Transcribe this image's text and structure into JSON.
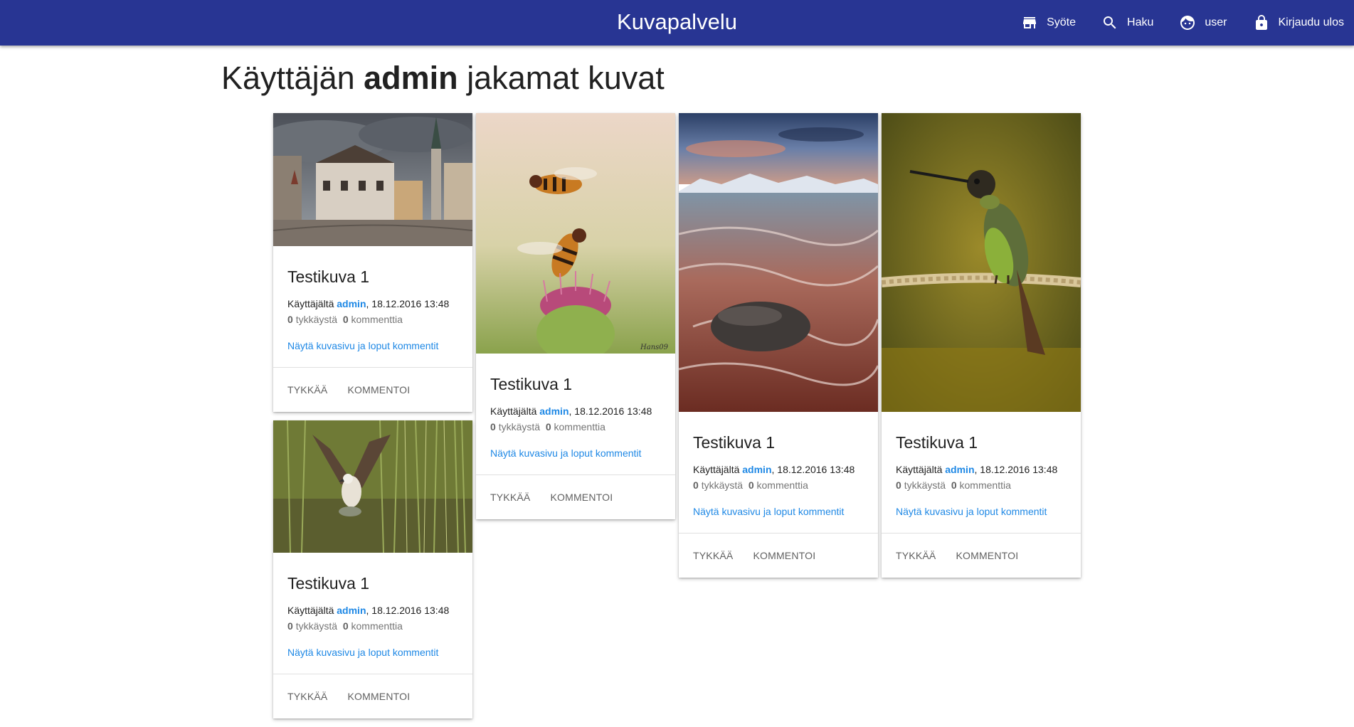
{
  "app": {
    "title": "Kuvapalvelu"
  },
  "nav": {
    "feed": "Syöte",
    "search": "Haku",
    "user": "user",
    "logout": "Kirjaudu ulos"
  },
  "page": {
    "title_prefix": "Käyttäjän",
    "title_user": "admin",
    "title_suffix": "jakamat kuvat"
  },
  "cards": [
    {
      "image_alt": "Tallinn old town street with church tower",
      "title": "Testikuva 1",
      "by_label": "Käyttäjältä",
      "username": "admin",
      "date": ", 18.12.2016 13:48",
      "likes": "0",
      "likes_label": "tykkäystä",
      "comments": "0",
      "comments_label": "kommenttia",
      "link": "Näytä kuvasivu ja loput kommentit",
      "like_btn": "TYKKÄÄ",
      "comment_btn": "KOMMENTOI"
    },
    {
      "image_alt": "Osprey flying over reeds",
      "title": "Testikuva 1",
      "by_label": "Käyttäjältä",
      "username": "admin",
      "date": ", 18.12.2016 13:48",
      "likes": "0",
      "likes_label": "tykkäystä",
      "comments": "0",
      "comments_label": "kommenttia",
      "link": "Näytä kuvasivu ja loput kommentit",
      "like_btn": "TYKKÄÄ",
      "comment_btn": "KOMMENTOI"
    },
    {
      "image_alt": "Hoverflies on a thistle flower",
      "title": "Testikuva 1",
      "by_label": "Käyttäjältä",
      "username": "admin",
      "date": ", 18.12.2016 13:48",
      "likes": "0",
      "likes_label": "tykkäystä",
      "comments": "0",
      "comments_label": "kommenttia",
      "link": "Näytä kuvasivu ja loput kommentit",
      "like_btn": "TYKKÄÄ",
      "comment_btn": "KOMMENTOI"
    },
    {
      "image_alt": "Waves on a shore with mountains at sunset",
      "title": "Testikuva 1",
      "by_label": "Käyttäjältä",
      "username": "admin",
      "date": ", 18.12.2016 13:48",
      "likes": "0",
      "likes_label": "tykkäystä",
      "comments": "0",
      "comments_label": "kommenttia",
      "link": "Näytä kuvasivu ja loput kommentit",
      "like_btn": "TYKKÄÄ",
      "comment_btn": "KOMMENTOI"
    },
    {
      "image_alt": "Hummingbird perched on a mossy branch",
      "title": "Testikuva 1",
      "by_label": "Käyttäjältä",
      "username": "admin",
      "date": ", 18.12.2016 13:48",
      "likes": "0",
      "likes_label": "tykkäystä",
      "comments": "0",
      "comments_label": "kommenttia",
      "link": "Näytä kuvasivu ja loput kommentit",
      "like_btn": "TYKKÄÄ",
      "comment_btn": "KOMMENTOI"
    }
  ],
  "colors": {
    "appbar": "#283593",
    "link": "#1e88e5"
  },
  "icons": {
    "feed": "store-icon",
    "search": "search-icon",
    "user": "face-icon",
    "logout": "lock-icon"
  }
}
